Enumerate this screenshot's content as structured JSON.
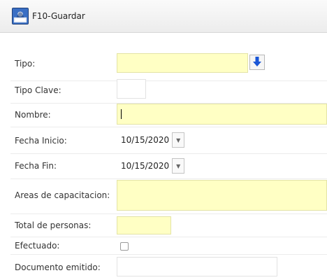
{
  "toolbar": {
    "save_label": "F10-Guardar",
    "save_icon": "save-disk-icon"
  },
  "form": {
    "tipo": {
      "label": "Tipo:",
      "value": "",
      "lookup_icon": "arrow-down-icon"
    },
    "tipo_clave": {
      "label": "Tipo Clave:",
      "value": ""
    },
    "nombre": {
      "label": "Nombre:",
      "value": ""
    },
    "fecha_inicio": {
      "label": "Fecha Inicio:",
      "value": "10/15/2020",
      "dropdown_icon": "▼"
    },
    "fecha_fin": {
      "label": "Fecha Fin:",
      "value": "10/15/2020",
      "dropdown_icon": "▼"
    },
    "areas": {
      "label": "Areas de capacitacion:",
      "value": ""
    },
    "total_personas": {
      "label": "Total de personas:",
      "value": ""
    },
    "efectuado": {
      "label": "Efectuado:",
      "checked": false
    },
    "documento": {
      "label": "Documento emitido:",
      "value": ""
    }
  },
  "colors": {
    "required_field_bg": "#ffffc4",
    "lookup_arrow": "#1a56d6",
    "label_text": "#333333"
  }
}
